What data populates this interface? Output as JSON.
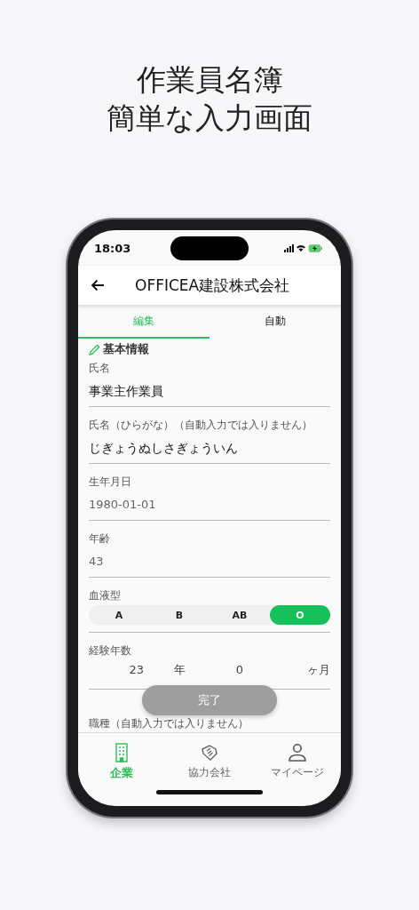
{
  "headline": [
    "作業員名簿",
    "簡単な入力画面"
  ],
  "status_bar": {
    "time": "18:03"
  },
  "app_bar": {
    "title": "OFFICEA建設株式会社"
  },
  "tabs": [
    {
      "label": "編集",
      "selected": true
    },
    {
      "label": "自動",
      "selected": false
    }
  ],
  "section": {
    "title": "基本情報"
  },
  "fields": [
    {
      "kind": "input",
      "label": "氏名",
      "value": "事業主作業員"
    },
    {
      "kind": "input",
      "label": "氏名（ひらがな）（自動入力では入りません）",
      "value": "じぎょうぬしさぎょういん"
    },
    {
      "kind": "readonly",
      "label": "生年月日",
      "value": "1980-01-01"
    },
    {
      "kind": "readonly",
      "label": "年齢",
      "value": "43"
    },
    {
      "kind": "segmented",
      "label": "血液型",
      "options": [
        {
          "label": "A",
          "selected": false
        },
        {
          "label": "B",
          "selected": false
        },
        {
          "label": "AB",
          "selected": false
        },
        {
          "label": "O",
          "selected": true
        }
      ]
    },
    {
      "kind": "duration",
      "label": "経験年数",
      "years": "23",
      "years_unit": "年",
      "months": "0",
      "months_unit": "ヶ月"
    },
    {
      "kind": "label",
      "label": "職種（自動入力では入りません）"
    }
  ],
  "done_button": {
    "label": "完了"
  },
  "bottom_nav": [
    {
      "label": "企業",
      "selected": true
    },
    {
      "label": "協力会社",
      "selected": false
    },
    {
      "label": "マイページ",
      "selected": false
    }
  ]
}
